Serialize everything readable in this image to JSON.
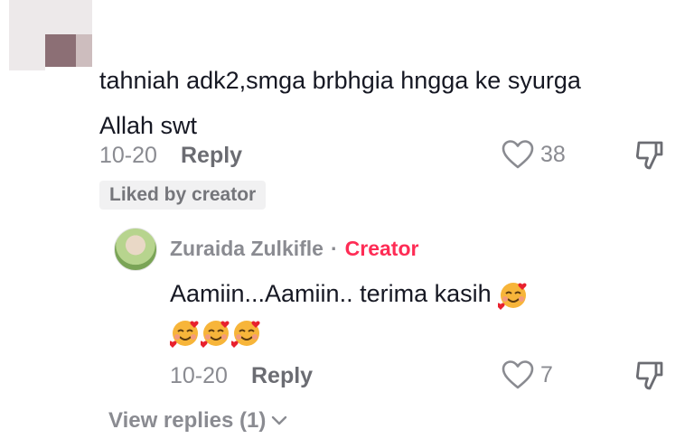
{
  "comment": {
    "text": "tahniah adk2,smga brbhgia hngga ke syurga Allah swt",
    "date": "10-20",
    "reply_label": "Reply",
    "like_count": "38",
    "badge": "Liked by creator"
  },
  "reply": {
    "author": "Zuraida Zulkifle",
    "separator": "·",
    "author_tag": "Creator",
    "text": "Aamiin...Aamiin.. terima kasih",
    "date": "10-20",
    "reply_label": "Reply",
    "like_count": "7"
  },
  "view_replies": "View replies (1)",
  "colors": {
    "creator_accent": "#fe2c55",
    "meta_gray": "#8a8b91",
    "text_dark": "#161823"
  },
  "icons": [
    "heart-icon",
    "dislike-icon",
    "smiling-hearts-emoji",
    "chevron-down-icon"
  ]
}
